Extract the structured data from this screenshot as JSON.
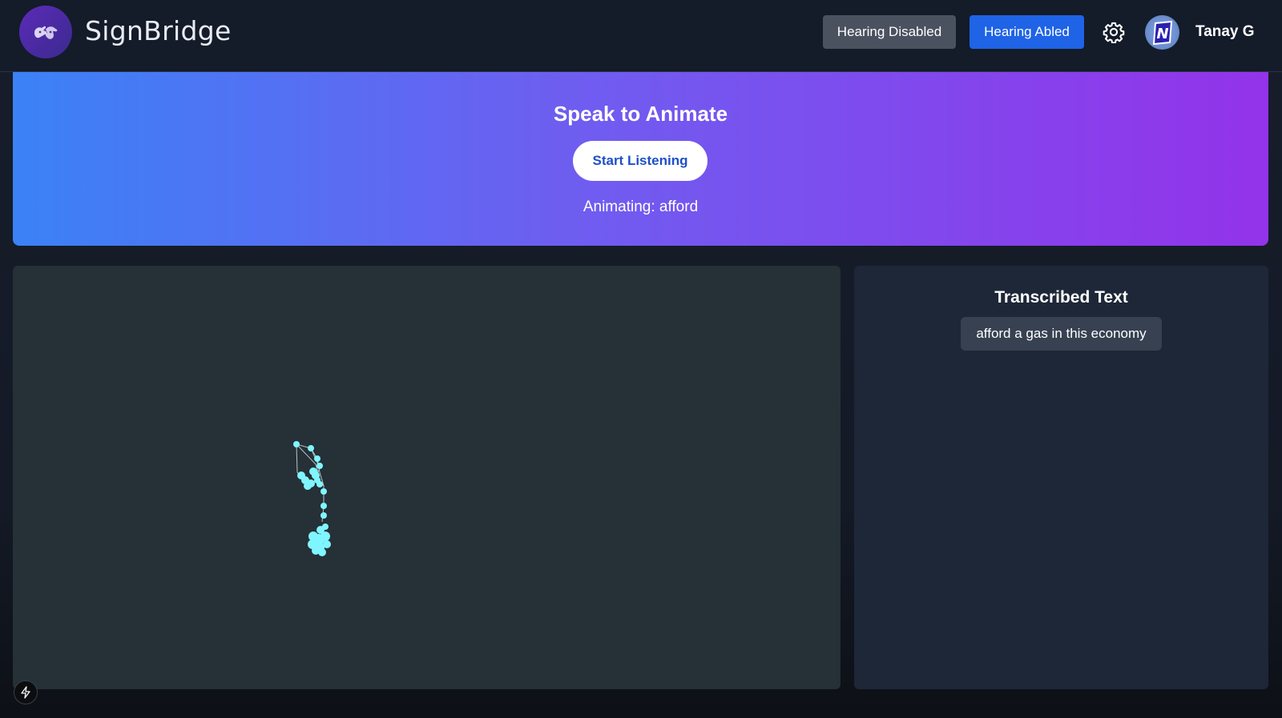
{
  "header": {
    "app_title": "SignBridge",
    "logo_icon": "sign-hands-icon",
    "hearing_disabled_label": "Hearing Disabled",
    "hearing_abled_label": "Hearing Abled",
    "settings_icon": "gear-icon",
    "avatar_letter": "N",
    "user_name": "Tanay G",
    "colors": {
      "header_bg": "#141b29",
      "disabled_btn": "#4a5260",
      "abled_btn": "#1f63e6"
    }
  },
  "banner": {
    "title": "Speak to Animate",
    "start_button_label": "Start Listening",
    "animating_text": "Animating: afford",
    "gradient": [
      "#3b82f6",
      "#9333ea"
    ]
  },
  "transcript": {
    "title": "Transcribed Text",
    "text": "afford a gas in this economy"
  },
  "animation": {
    "joint_color": "#7ff6ff",
    "bone_color": "#b8c4c8"
  },
  "footer": {
    "bolt_icon": "lightning-bolt-icon"
  }
}
